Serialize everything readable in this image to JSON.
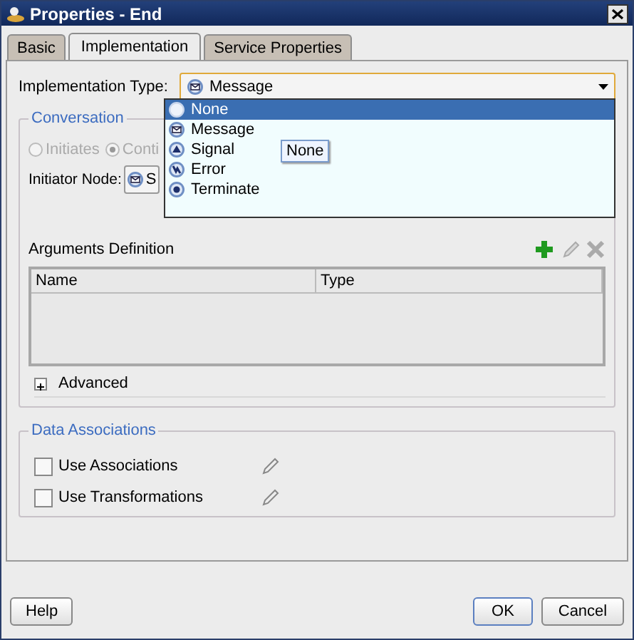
{
  "window": {
    "title": "Properties - End"
  },
  "tabs": [
    {
      "label": "Basic",
      "selected": false
    },
    {
      "label": "Implementation",
      "selected": true
    },
    {
      "label": "Service Properties",
      "selected": false
    }
  ],
  "implementation_type": {
    "label": "Implementation Type:",
    "value": {
      "label": "Message",
      "kind": "message"
    },
    "options": [
      {
        "label": "None",
        "kind": "none",
        "selected": true
      },
      {
        "label": "Message",
        "kind": "message",
        "selected": false
      },
      {
        "label": "Signal",
        "kind": "signal",
        "selected": false
      },
      {
        "label": "Error",
        "kind": "error",
        "selected": false
      },
      {
        "label": "Terminate",
        "kind": "terminate",
        "selected": false
      }
    ]
  },
  "tooltip": "None",
  "conversation": {
    "title": "Conversation",
    "disabled": true,
    "options": [
      {
        "label": "Initiates",
        "selected": false
      },
      {
        "label": "Conti",
        "selected": true
      }
    ],
    "initiator_label": "Initiator Node:",
    "initiator_value": "S"
  },
  "arguments": {
    "title": "Arguments Definition",
    "columns": [
      "Name",
      "Type"
    ]
  },
  "advanced": {
    "label": "Advanced",
    "expanded": false
  },
  "data_associations": {
    "title": "Data Associations",
    "options": [
      {
        "label": "Use Associations",
        "checked": false
      },
      {
        "label": "Use Transformations",
        "checked": false
      }
    ]
  },
  "buttons": [
    {
      "label": "Help",
      "kind": "left"
    },
    {
      "label": "OK",
      "kind": "default"
    },
    {
      "label": "Cancel",
      "kind": "normal"
    }
  ]
}
